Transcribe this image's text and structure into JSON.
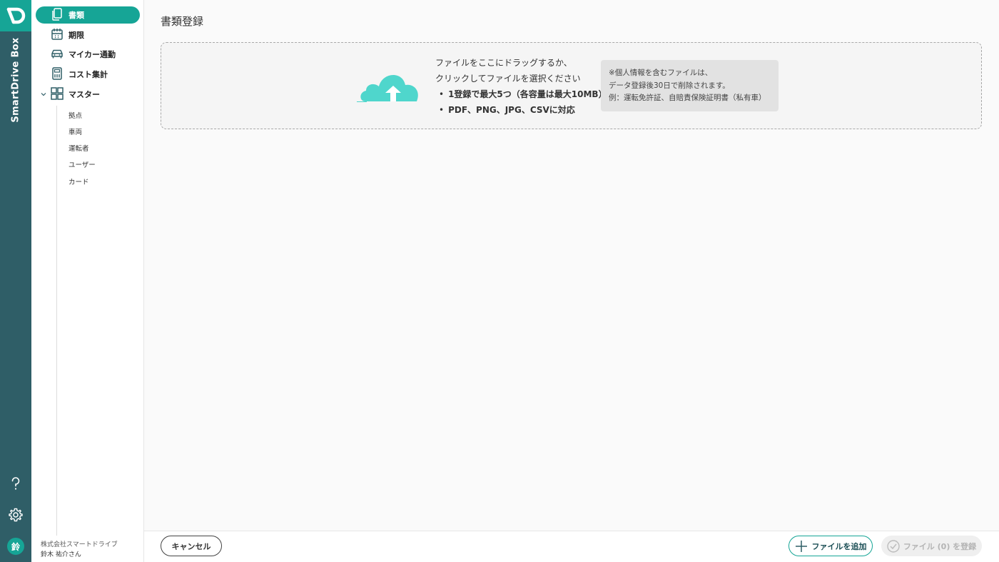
{
  "rail": {
    "brand": "SmartDrive Box",
    "avatar_initial": "鈴"
  },
  "sidebar": {
    "items": [
      {
        "label": "書類",
        "icon": "documents-icon",
        "active": true
      },
      {
        "label": "期限",
        "icon": "calendar-icon",
        "active": false
      },
      {
        "label": "マイカー通勤",
        "icon": "car-icon",
        "active": false
      },
      {
        "label": "コスト集計",
        "icon": "calculator-icon",
        "active": false
      },
      {
        "label": "マスター",
        "icon": "grid-icon",
        "active": false,
        "expanded": true
      }
    ],
    "master_sub_items": [
      {
        "label": "拠点"
      },
      {
        "label": "車両"
      },
      {
        "label": "運転者"
      },
      {
        "label": "ユーザー"
      },
      {
        "label": "カード"
      }
    ],
    "company": "株式会社スマートドライブ",
    "user": "鈴木 祐介さん"
  },
  "main": {
    "title": "書類登録",
    "dropzone": {
      "line1": "ファイルをここにドラッグするか、",
      "line2": "クリックしてファイルを選択ください",
      "bullets": [
        "1登録で最大5つ（各容量は最大10MB）",
        "PDF、PNG、JPG、CSVに対応"
      ],
      "notice": [
        "※個人情報を含むファイルは、",
        "データ登録後30日で削除されます。",
        "例：運転免許証、自賠責保険証明書（私有車）"
      ]
    }
  },
  "footer": {
    "cancel_label": "キャンセル",
    "add_label": "ファイルを追加",
    "register_label": "ファイル (0) を登録"
  },
  "colors": {
    "accent": "#16a596",
    "rail": "#2f5e67",
    "cloud": "#4fd6cc"
  }
}
